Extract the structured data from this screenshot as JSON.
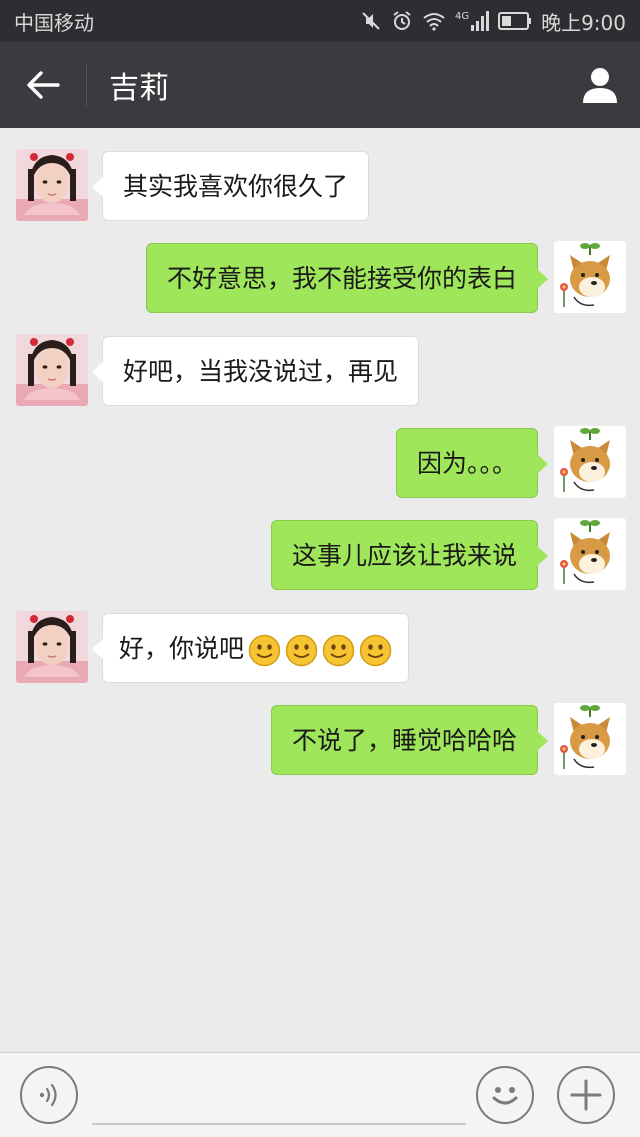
{
  "status_bar": {
    "carrier": "中国移动",
    "network": "4G",
    "time": "晚上9:00"
  },
  "header": {
    "title": "吉莉"
  },
  "colors": {
    "status_bar_bg": "#2d2e31",
    "nav_bar_bg": "#3a3b3f",
    "chat_bg": "#ebebeb",
    "outgoing_bubble": "#9fe65a",
    "incoming_bubble": "#ffffff"
  },
  "messages": [
    {
      "side": "left",
      "sender": "吉莉",
      "text": "其实我喜欢你很久了"
    },
    {
      "side": "right",
      "sender": "me",
      "text": "不好意思，我不能接受你的表白"
    },
    {
      "side": "left",
      "sender": "吉莉",
      "text": "好吧，当我没说过，再见"
    },
    {
      "side": "right",
      "sender": "me",
      "text": "因为。。。"
    },
    {
      "side": "right",
      "sender": "me",
      "text": "这事儿应该让我来说"
    },
    {
      "side": "left",
      "sender": "吉莉",
      "text": "好，你说吧",
      "emoji": [
        "smile-emoji",
        "smile-emoji",
        "smile-emoji",
        "smile-emoji"
      ]
    },
    {
      "side": "right",
      "sender": "me",
      "text": "不说了，睡觉哈哈哈"
    }
  ],
  "input_bar": {
    "voice_icon": "voice-icon",
    "emoji_icon": "emoji-icon",
    "plus_icon": "plus-icon",
    "input_value": ""
  }
}
